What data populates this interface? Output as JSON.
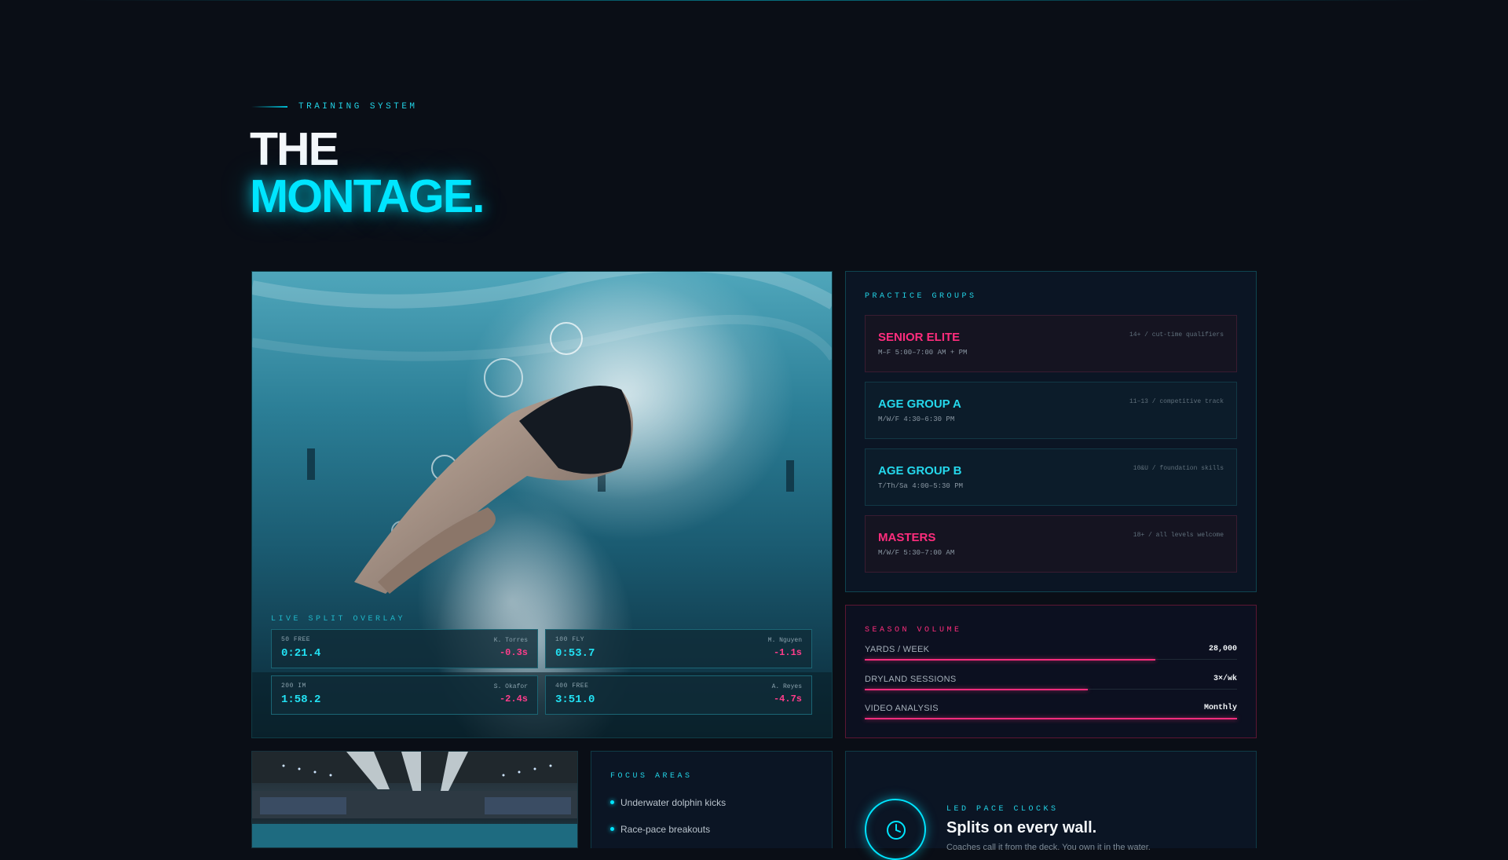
{
  "header": {
    "eyebrow": "TRAINING SYSTEM",
    "title_line1": "THE",
    "title_line2": "MONTAGE."
  },
  "hero": {
    "image_alt": "swimmer diving underwater",
    "overlay_label": "LIVE SPLIT OVERLAY",
    "splits": [
      {
        "event": "50 FREE",
        "time": "0:21.4",
        "swimmer": "K. Torres",
        "delta": "-0.3s"
      },
      {
        "event": "100 FLY",
        "time": "0:53.7",
        "swimmer": "M. Nguyen",
        "delta": "-1.1s"
      },
      {
        "event": "200 IM",
        "time": "1:58.2",
        "swimmer": "S. Okafor",
        "delta": "-2.4s"
      },
      {
        "event": "400 FREE",
        "time": "3:51.0",
        "swimmer": "A. Reyes",
        "delta": "-4.7s"
      }
    ]
  },
  "practice_groups": {
    "label": "PRACTICE GROUPS",
    "groups": [
      {
        "name": "SENIOR ELITE",
        "schedule": "M–F 5:00–7:00 AM + PM",
        "meta": "14+ / cut-time qualifiers",
        "accent": "pink"
      },
      {
        "name": "AGE GROUP A",
        "schedule": "M/W/F 4:30–6:30 PM",
        "meta": "11–13 / competitive track",
        "accent": "cyan"
      },
      {
        "name": "AGE GROUP B",
        "schedule": "T/Th/Sa 4:00–5:30 PM",
        "meta": "10&U / foundation skills",
        "accent": "cyan"
      },
      {
        "name": "MASTERS",
        "schedule": "M/W/F 5:30–7:00 AM",
        "meta": "18+ / all levels welcome",
        "accent": "pink"
      }
    ]
  },
  "season_volume": {
    "label": "SEASON VOLUME",
    "rows": [
      {
        "name": "YARDS / WEEK",
        "value": "28,000",
        "fraction": 0.78
      },
      {
        "name": "DRYLAND SESSIONS",
        "value": "3×/wk",
        "fraction": 0.6
      },
      {
        "name": "VIDEO ANALYSIS",
        "value": "Monthly",
        "fraction": 1.0
      }
    ]
  },
  "focus_areas": {
    "label": "FOCUS AREAS",
    "items": [
      "Underwater dolphin kicks",
      "Race-pace breakouts"
    ]
  },
  "led_clocks": {
    "label": "LED PACE CLOCKS",
    "title": "Splits on every wall.",
    "description": "Coaches call it from the deck. You own it in the water.",
    "icon": "clock-icon"
  },
  "colors": {
    "background": "#0a0e16",
    "cyan_accent": "#00e5ff",
    "pink_accent": "#ff2d7d"
  }
}
